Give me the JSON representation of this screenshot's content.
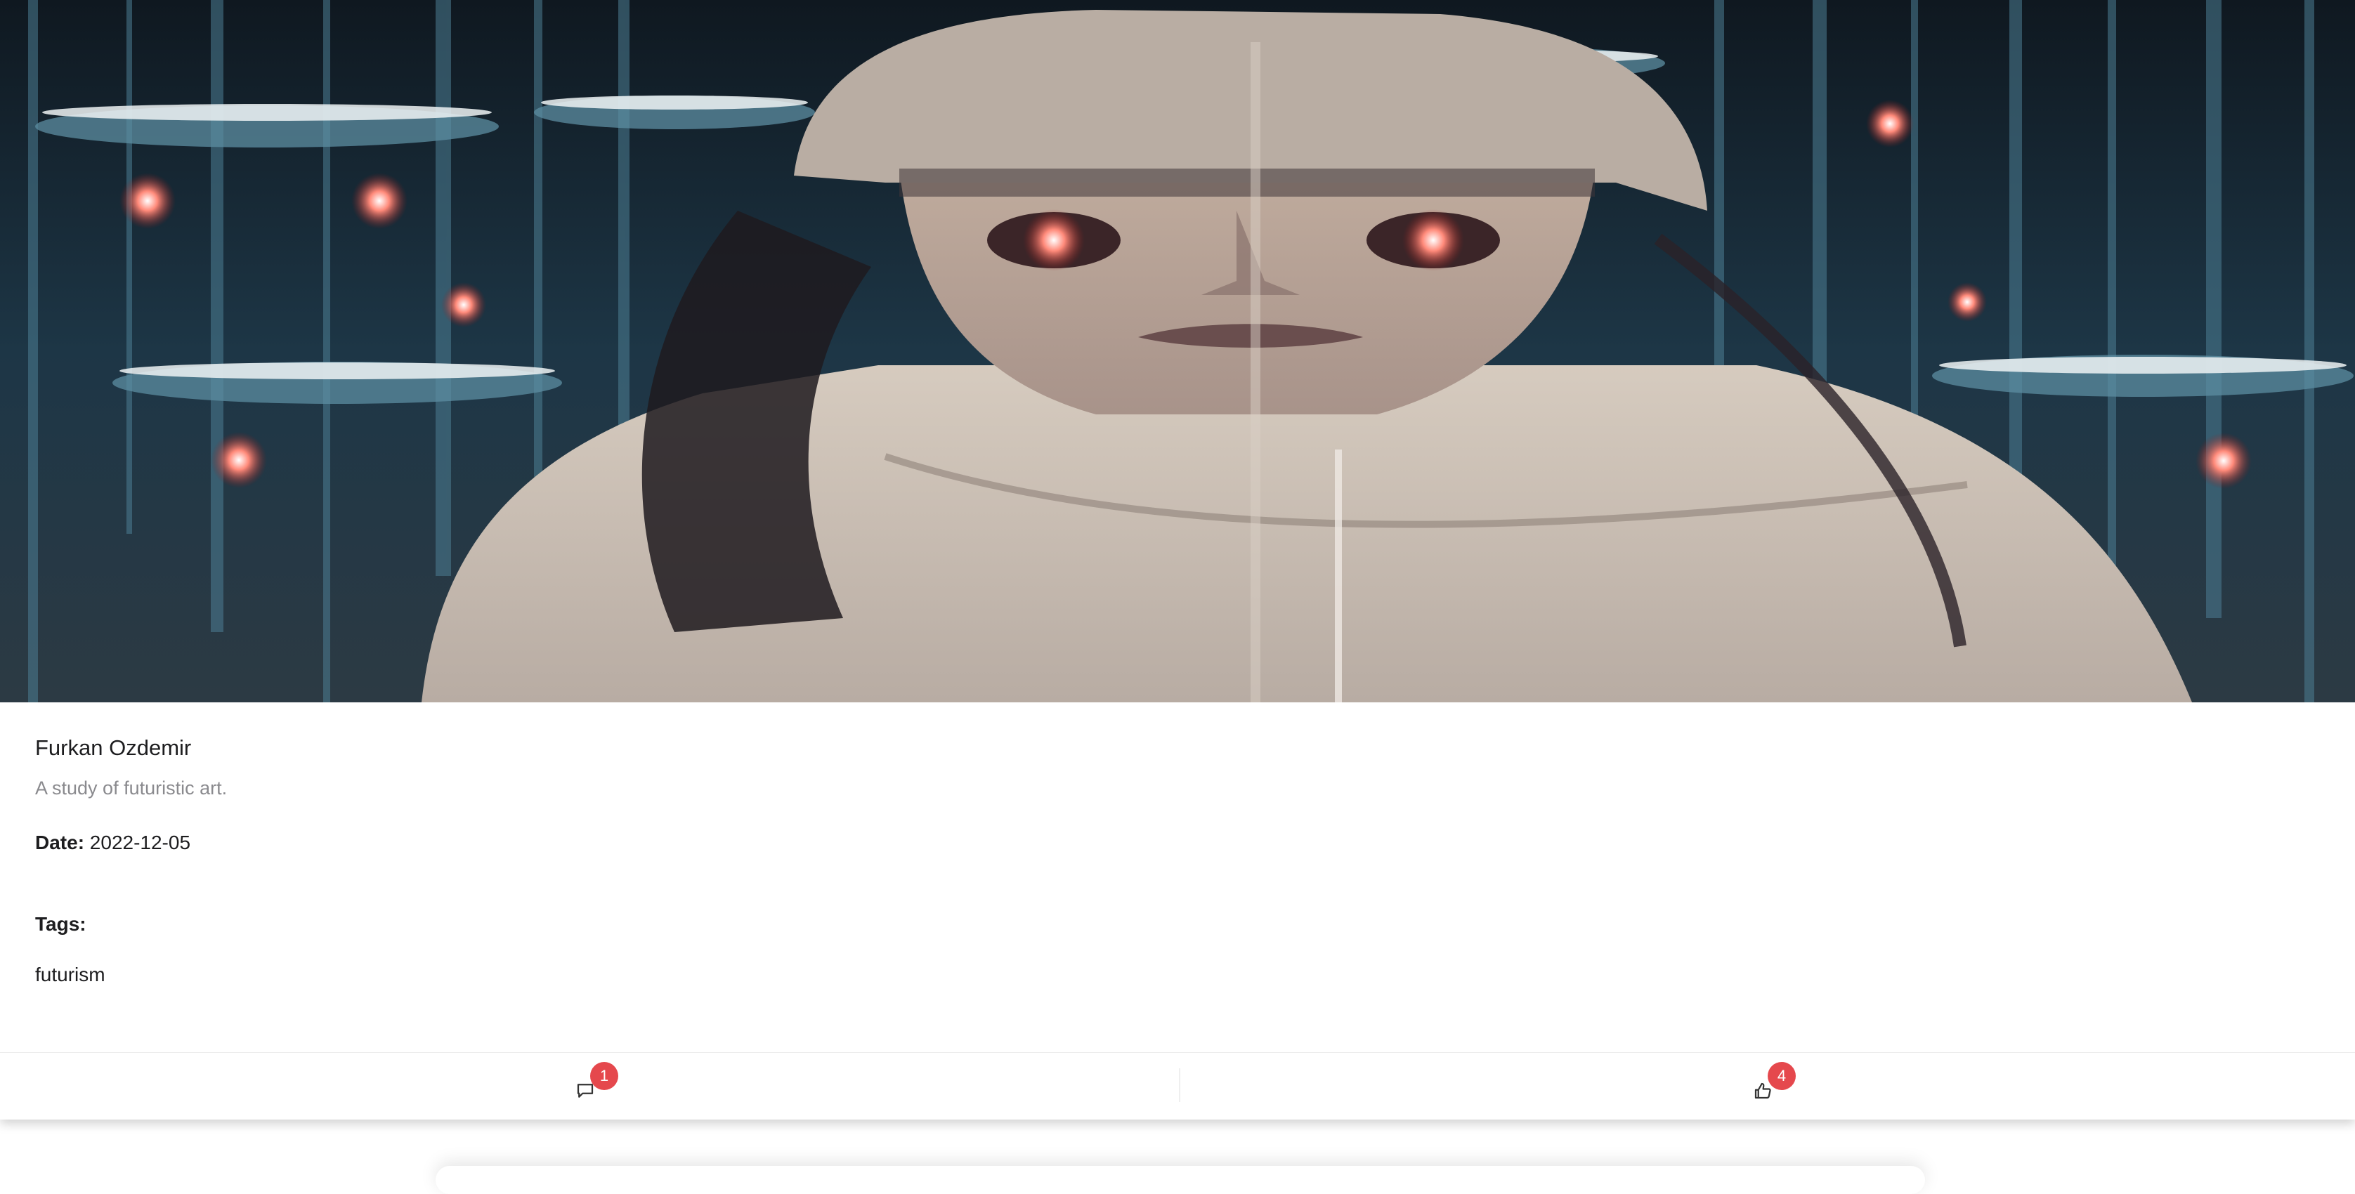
{
  "post": {
    "author": "Furkan Ozdemir",
    "description": "A study of futuristic art.",
    "date_label": "Date:",
    "date_value": "2022-12-05",
    "tags_label": "Tags:",
    "tags": [
      "futurism"
    ]
  },
  "actions": {
    "comments": {
      "icon": "comment-icon",
      "count": "1"
    },
    "likes": {
      "icon": "like-icon",
      "count": "4"
    }
  },
  "colors": {
    "badge": "#e5484d",
    "text_primary": "#1d1d1f",
    "text_secondary": "#8a8a8e"
  }
}
